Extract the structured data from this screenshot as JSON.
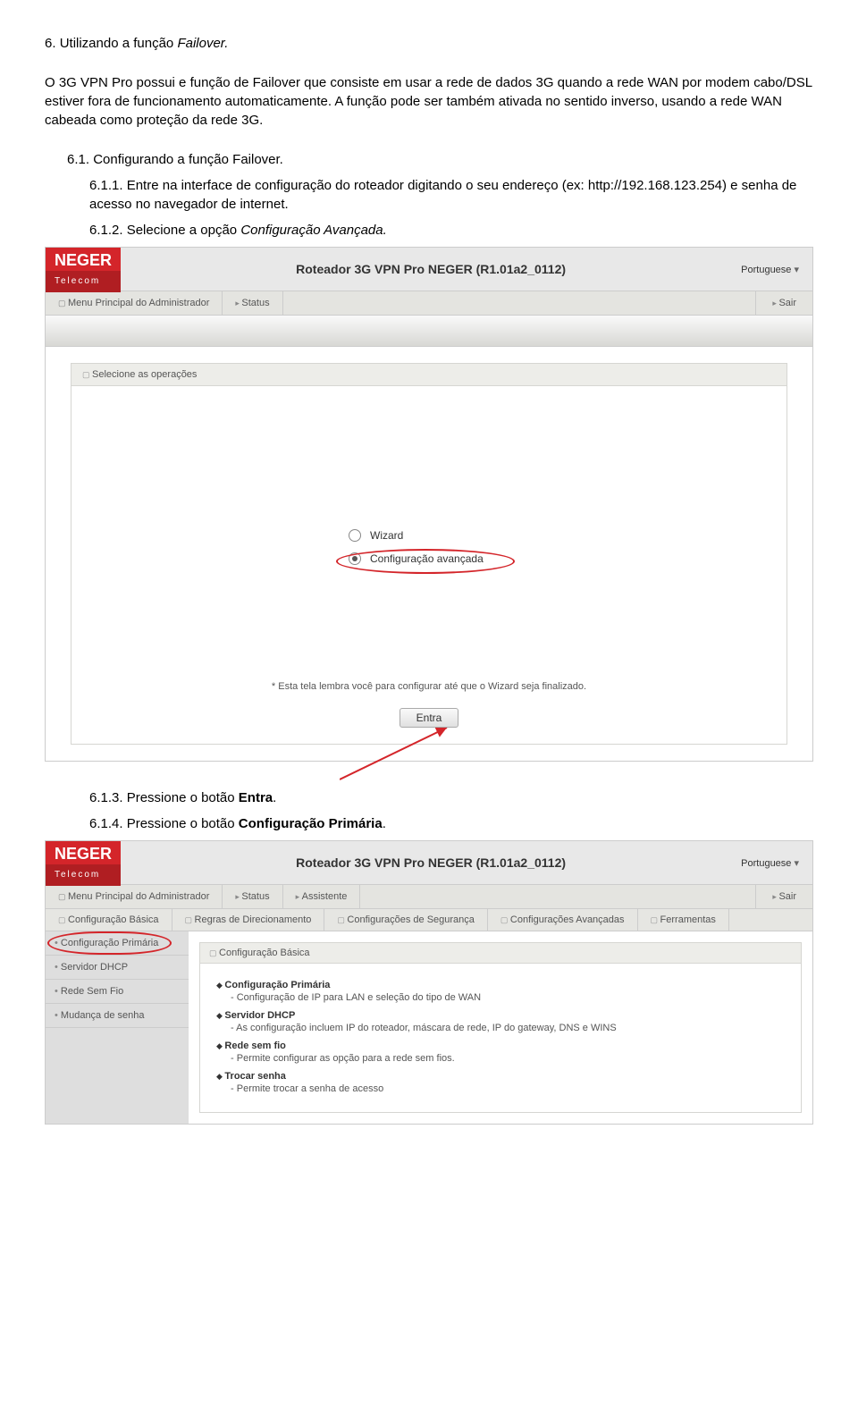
{
  "doc": {
    "section_num": "6.",
    "section_title": "Utilizando a função ",
    "section_title_em": "Failover.",
    "para1": "O 3G VPN Pro possui e função de Failover que consiste em usar a rede de dados 3G quando a rede WAN por modem cabo/DSL estiver fora de funcionamento automaticamente. A função pode ser também ativada no sentido inverso, usando a rede WAN cabeada como proteção da rede 3G.",
    "sub_num": "6.1.",
    "sub_title": "Configurando a função Failover.",
    "step1_num": "6.1.1.",
    "step1_text": "Entre na interface de configuração do roteador digitando o seu endereço (ex: http://192.168.123.254) e senha de acesso no navegador de internet.",
    "step2_num": "6.1.2.",
    "step2_text_a": "Selecione a opção ",
    "step2_text_em": "Configuração Avançada.",
    "step3_num": "6.1.3.",
    "step3_text_a": "Pressione o botão ",
    "step3_bold": "Entra",
    "step3_dot": ".",
    "step4_num": "6.1.4.",
    "step4_text_a": "Pressione o botão ",
    "step4_bold": "Configuração Primária",
    "step4_dot": "."
  },
  "router1": {
    "logo_top": "NEGER",
    "logo_bottom": "Telecom",
    "title": "Roteador 3G VPN Pro NEGER (R1.01a2_0112)",
    "lang": "Portuguese",
    "nav_main": "Menu Principal do Administrador",
    "nav_status": "Status",
    "nav_exit": "Sair",
    "panel_title": "Selecione as operações",
    "opt_wizard": "Wizard",
    "opt_adv": "Configuração avançada",
    "note": "* Esta tela lembra você para configurar até que o Wizard seja finalizado.",
    "entra_btn": "Entra"
  },
  "router2": {
    "logo_top": "NEGER",
    "logo_bottom": "Telecom",
    "title": "Roteador 3G VPN Pro NEGER (R1.01a2_0112)",
    "lang": "Portuguese",
    "nav_main": "Menu Principal do Administrador",
    "nav_status": "Status",
    "nav_assist": "Assistente",
    "nav_exit": "Sair",
    "tab1": "Configuração Básica",
    "tab2": "Regras de Direcionamento",
    "tab3": "Configurações de Segurança",
    "tab4": "Configurações Avançadas",
    "tab5": "Ferramentas",
    "side1": "Configuração Primária",
    "side2": "Servidor DHCP",
    "side3": "Rede Sem Fio",
    "side4": "Mudança de senha",
    "panel_title": "Configuração Básica",
    "b1_title": "Configuração Primária",
    "b1_desc": "Configuração de IP para LAN e seleção do tipo de WAN",
    "b2_title": "Servidor DHCP",
    "b2_desc": "As configuração incluem IP do roteador, máscara de rede, IP do gateway, DNS e WINS",
    "b3_title": "Rede sem fio",
    "b3_desc": "Permite configurar as opção para a rede sem fios.",
    "b4_title": "Trocar senha",
    "b4_desc": "Permite trocar a senha de acesso"
  }
}
